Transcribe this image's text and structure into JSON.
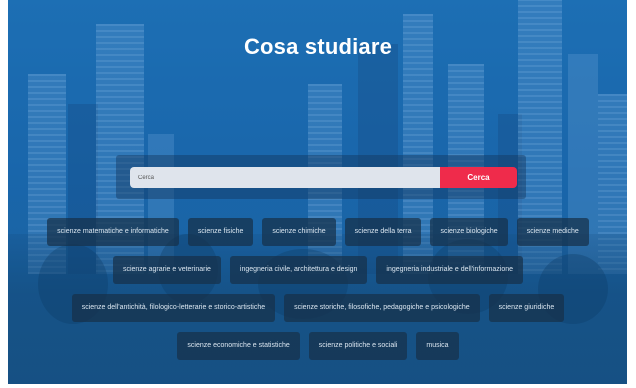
{
  "page": {
    "title": "Cosa studiare"
  },
  "search": {
    "placeholder": "Cerca",
    "button_label": "Cerca"
  },
  "colors": {
    "accent": "#ef2b4b",
    "overlay": "#1a6ebe",
    "chip_bg": "#16304a"
  },
  "chip_rows": [
    [
      "scienze matematiche e informatiche",
      "scienze fisiche",
      "scienze chimiche",
      "scienze della terra",
      "scienze biologiche",
      "scienze mediche"
    ],
    [
      "scienze agrarie e veterinarie",
      "ingegneria civile, architettura e design",
      "ingegneria industriale e dell'informazione"
    ],
    [
      "scienze dell'antichità, filologico-letterarie e storico-artistiche",
      "scienze storiche, filosofiche, pedagogiche e psicologiche",
      "scienze giuridiche"
    ],
    [
      "scienze economiche e statistiche",
      "scienze politiche e sociali",
      "musica"
    ]
  ]
}
